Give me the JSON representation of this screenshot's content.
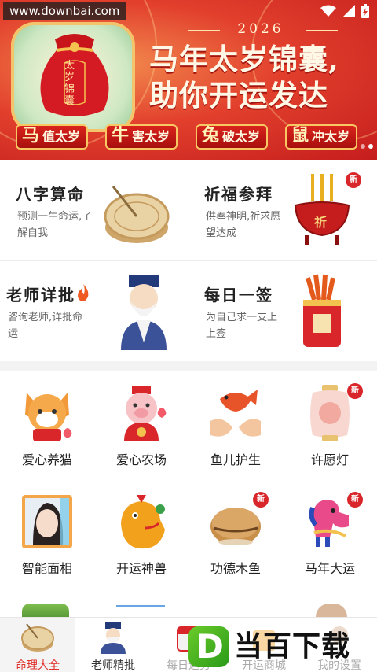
{
  "status_bar": {
    "watermark_url": "www.downbai.com",
    "icons": [
      "wifi-icon",
      "signal-icon",
      "battery-charging-icon"
    ]
  },
  "banner": {
    "year": "2026",
    "title_line1": "马年太岁锦囊,",
    "title_line2": "助你开运发达",
    "bag_text": "太岁锦囊",
    "tags": [
      {
        "char": "马",
        "text": "值太岁"
      },
      {
        "char": "牛",
        "text": "害太岁"
      },
      {
        "char": "兔",
        "text": "破太岁"
      },
      {
        "char": "鼠",
        "text": "冲太岁"
      }
    ],
    "colors": {
      "bg": "#d8302a",
      "tag": "#b9150f",
      "tag_border": "#f7c764"
    }
  },
  "features": [
    {
      "title": "八字算命",
      "desc": "预测一生命运,了解自我",
      "icon": "sundial-icon",
      "is_new": false
    },
    {
      "title": "祈福参拜",
      "desc": "供奉神明,祈求愿望达成",
      "icon": "incense-burner-icon",
      "is_new": true,
      "badge": "新",
      "burner_text": "祈"
    },
    {
      "title": "老师详批",
      "desc": "咨询老师,详批命运",
      "icon": "master-icon",
      "is_new": false
    },
    {
      "title": "每日一签",
      "desc": "为自己求一支上上签",
      "icon": "fortune-sticks-icon",
      "is_new": false
    }
  ],
  "grid_items": [
    {
      "label": "爱心养猫",
      "icon": "cat-icon",
      "is_new": false
    },
    {
      "label": "爱心农场",
      "icon": "pig-icon",
      "is_new": false
    },
    {
      "label": "鱼儿护生",
      "icon": "fish-icon",
      "is_new": false
    },
    {
      "label": "许愿灯",
      "icon": "lantern-icon",
      "is_new": true
    },
    {
      "label": "智能面相",
      "icon": "face-reading-icon",
      "is_new": false
    },
    {
      "label": "开运神兽",
      "icon": "lucky-beast-icon",
      "is_new": false
    },
    {
      "label": "功德木鱼",
      "icon": "wooden-fish-icon",
      "is_new": true
    },
    {
      "label": "马年大运",
      "icon": "horse-icon",
      "is_new": true
    }
  ],
  "new_badge": "新",
  "bottom_nav": [
    {
      "label": "命理大全",
      "icon": "sundial-icon",
      "active": true
    },
    {
      "label": "老师精批",
      "icon": "master-icon",
      "active": false
    },
    {
      "label": "每日运势",
      "icon": "calendar-icon",
      "active": false
    },
    {
      "label": "开运商城",
      "icon": "shop-icon",
      "active": false
    },
    {
      "label": "我的设置",
      "icon": "profile-icon",
      "active": false
    }
  ],
  "logo_overlay": {
    "text": "当百下载",
    "letter": "D"
  }
}
